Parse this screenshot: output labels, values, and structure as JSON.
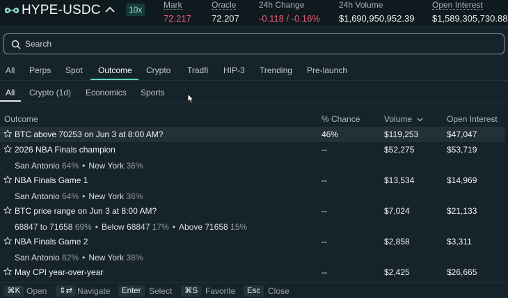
{
  "ticker": {
    "pair": "HYPE-USDC",
    "leverage": "10x",
    "stats": [
      {
        "label": "Mark",
        "value": "72.217",
        "color": "#ef5b72"
      },
      {
        "label": "Oracle",
        "value": "72.207"
      },
      {
        "label": "24h Change",
        "value": "-0.118 / -0.16%",
        "color": "#ef5b72"
      },
      {
        "label": "24h Volume",
        "value": "$1,690,950,952.39"
      },
      {
        "label": "Open Interest",
        "value": "$1,589,305,730.88"
      }
    ]
  },
  "search": {
    "placeholder": "Search"
  },
  "tabs": [
    "All",
    "Perps",
    "Spot",
    "Outcome",
    "Crypto",
    "Tradfi",
    "HIP-3",
    "Trending",
    "Pre-launch"
  ],
  "active_tab": "Outcome",
  "subtabs": [
    "All",
    "Crypto (1d)",
    "Economics",
    "Sports"
  ],
  "active_subtab": "All",
  "columns": {
    "outcome": "Outcome",
    "chance": "% Chance",
    "volume": "Volume",
    "open_interest": "Open Interest"
  },
  "rows": [
    {
      "name": "BTC above 70253 on Jun 3 at 8:00 AM?",
      "chance": "46%",
      "volume": "$119,253",
      "oi": "$47,047",
      "highlight": true
    },
    {
      "name": "2026 NBA Finals champion",
      "chance": "--",
      "volume": "$52,275",
      "oi": "$53,719",
      "sub": [
        {
          "name": "San Antonio",
          "pct": "64%"
        },
        {
          "name": "New York",
          "pct": "36%"
        }
      ]
    },
    {
      "name": "NBA Finals Game 1",
      "chance": "--",
      "volume": "$13,534",
      "oi": "$14,969",
      "sub": [
        {
          "name": "San Antonio",
          "pct": "64%"
        },
        {
          "name": "New York",
          "pct": "36%"
        }
      ]
    },
    {
      "name": "BTC price range on Jun 3 at 8:00 AM?",
      "chance": "--",
      "volume": "$7,024",
      "oi": "$21,133",
      "sub": [
        {
          "name": "68847 to 71658",
          "pct": "69%"
        },
        {
          "name": "Below 68847",
          "pct": "17%"
        },
        {
          "name": "Above 71658",
          "pct": "15%"
        }
      ]
    },
    {
      "name": "NBA Finals Game 2",
      "chance": "--",
      "volume": "$2,858",
      "oi": "$3,311",
      "sub": [
        {
          "name": "San Antonio",
          "pct": "62%"
        },
        {
          "name": "New York",
          "pct": "38%"
        }
      ]
    },
    {
      "name": "May CPI year-over-year",
      "chance": "--",
      "volume": "$2,425",
      "oi": "$26,665"
    }
  ],
  "footer": [
    {
      "key": "⌘K",
      "label": "Open"
    },
    {
      "key": "⇕⇄",
      "label": "Navigate"
    },
    {
      "key": "Enter",
      "label": "Select"
    },
    {
      "key": "⌘S",
      "label": "Favorite"
    },
    {
      "key": "Esc",
      "label": "Close"
    }
  ],
  "colors": {
    "accent": "#5fd2c0",
    "negative": "#ef5b72",
    "panel": "#17232a",
    "background": "#0f1a1f"
  }
}
